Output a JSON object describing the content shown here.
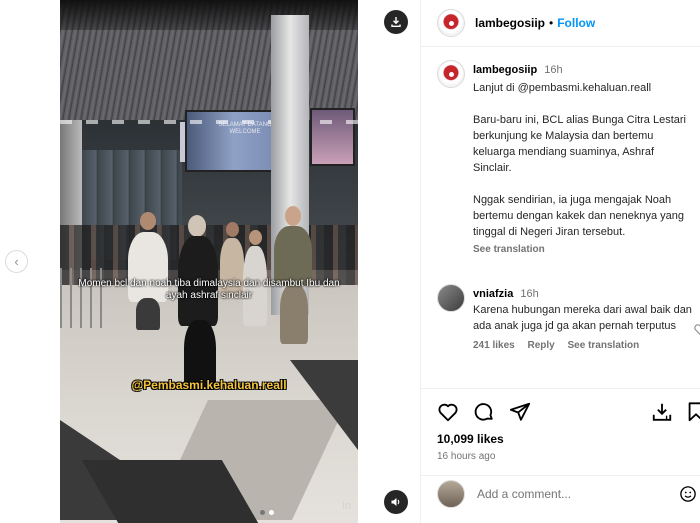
{
  "header": {
    "username": "lambegosiip",
    "separator": "•",
    "follow_label": "Follow"
  },
  "video": {
    "caption": "Momen bcl dan noah tiba dimalaysia dan disambut Ibu dan ayah ashraf sinclair",
    "watermark": "@Pembasmi.kehaluan.reall",
    "board_text": "SELAMAT DATANG WELCOME",
    "corner_mark": "In",
    "slide_count": 2,
    "active_slide": 2
  },
  "post": {
    "username": "lambegosiip",
    "time": "16h",
    "caption_lines": [
      "Lanjut di @pembasmi.kehaluan.reall",
      "",
      "Baru-baru ini, BCL alias Bunga Citra Lestari berkunjung ke Malaysia dan bertemu keluarga mendiang suaminya, Ashraf Sinclair.",
      "",
      "Nggak sendirian, ia juga mengajak Noah bertemu dengan kakek dan neneknya yang tinggal di Negeri Jiran tersebut."
    ],
    "see_translation": "See translation"
  },
  "comment": {
    "username": "vniafzia",
    "time": "16h",
    "text": "Karena hubungan mereka dari awal baik dan ada anak juga jd ga akan pernah terputus",
    "likes": "241 likes",
    "reply": "Reply",
    "see_translation": "See translation"
  },
  "actions": {
    "likes": "10,099 likes",
    "ago": "16 hours ago",
    "add_comment_placeholder": "Add a comment..."
  },
  "icons": [
    "download-icon",
    "volume-icon",
    "chevron-left-icon",
    "heart-icon",
    "comment-icon",
    "share-icon",
    "save-icon",
    "bookmark-icon",
    "emoji-icon"
  ]
}
